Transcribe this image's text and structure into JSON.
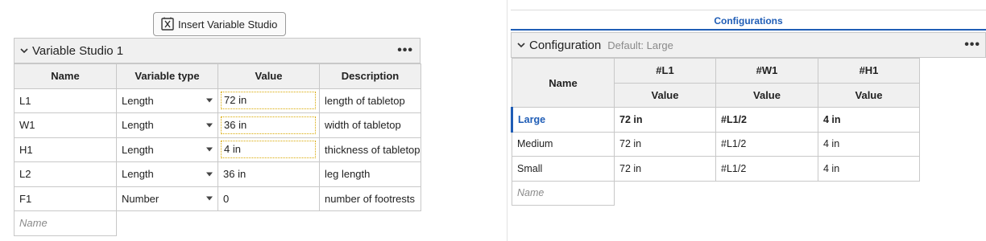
{
  "insert_button": {
    "label": "Insert Variable Studio",
    "icon": "insert-variable-studio-icon"
  },
  "variable_studio": {
    "title": "Variable Studio 1",
    "menu": "•••",
    "columns": [
      "Name",
      "Variable type",
      "Value",
      "Description"
    ],
    "rows": [
      {
        "name": "L1",
        "type": "Length",
        "value": "72 in",
        "description": "length of tabletop",
        "highlight": true
      },
      {
        "name": "W1",
        "type": "Length",
        "value": "36 in",
        "description": "width of tabletop",
        "highlight": true
      },
      {
        "name": "H1",
        "type": "Length",
        "value": "4 in",
        "description": "thickness of tabletop",
        "highlight": true
      },
      {
        "name": "L2",
        "type": "Length",
        "value": "36 in",
        "description": "leg length",
        "highlight": false
      },
      {
        "name": "F1",
        "type": "Number",
        "value": "0",
        "description": "number of footrests",
        "highlight": false
      }
    ],
    "new_row_placeholder": "Name"
  },
  "configurations": {
    "tab_title": "Configurations",
    "header": {
      "title": "Configuration",
      "default_label": "Default: Large",
      "menu": "•••"
    },
    "param_columns": [
      "#L1",
      "#W1",
      "#H1"
    ],
    "name_column": "Name",
    "value_label": "Value",
    "rows": [
      {
        "name": "Large",
        "values": [
          "72 in",
          "#L1/2",
          "4 in"
        ],
        "selected": true
      },
      {
        "name": "Medium",
        "values": [
          "72 in",
          "#L1/2",
          "4 in"
        ],
        "selected": false
      },
      {
        "name": "Small",
        "values": [
          "72 in",
          "#L1/2",
          "4 in"
        ],
        "selected": false
      }
    ],
    "new_row_placeholder": "Name"
  },
  "colors": {
    "accent": "#1f5db6",
    "highlight_border": "#d9a800",
    "header_bg": "#f0f0f0",
    "grid": "#c8c8c8"
  }
}
